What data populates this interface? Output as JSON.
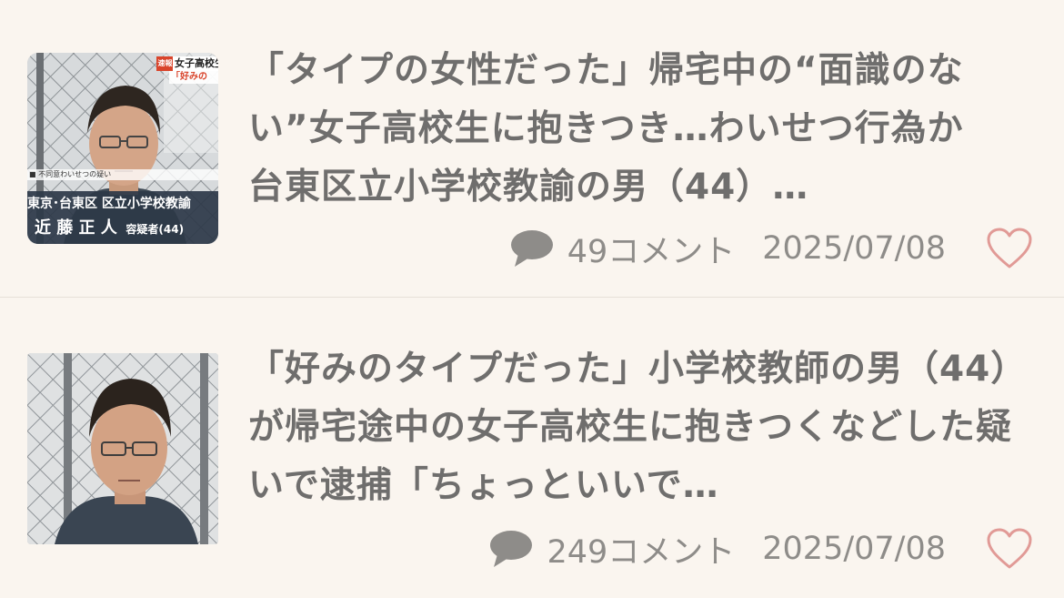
{
  "articles": [
    {
      "title": "「タイプの女性だった」帰宅中の“面識のない”女子高校生に抱きつき…わいせつ行為か　台東区立小学校教諭の男（44）…",
      "comments": "49コメント",
      "date": "2025/07/08",
      "thumbnail": {
        "badge": "速報",
        "headline": "女子高校生",
        "subheadline": "「好みの",
        "ticker": "■ 不同意わいせつの疑い",
        "caption_line1": "東京･台東区 区立小学校教諭",
        "caption_name": "近 藤 正 人",
        "caption_suffix": "容疑者(44)"
      }
    },
    {
      "title": "「好みのタイプだった」小学校教師の男（44）が帰宅途中の女子高校生に抱きつくなどした疑いで逮捕「ちょっといいで…",
      "comments": "249コメント",
      "date": "2025/07/08"
    }
  ],
  "colors": {
    "background": "#faf5ef",
    "title": "#6f6e6d",
    "meta": "#8e8c89",
    "heart": "#e19a96",
    "divider": "#e7e0d8"
  },
  "icons": [
    "comment-icon",
    "heart-icon"
  ]
}
